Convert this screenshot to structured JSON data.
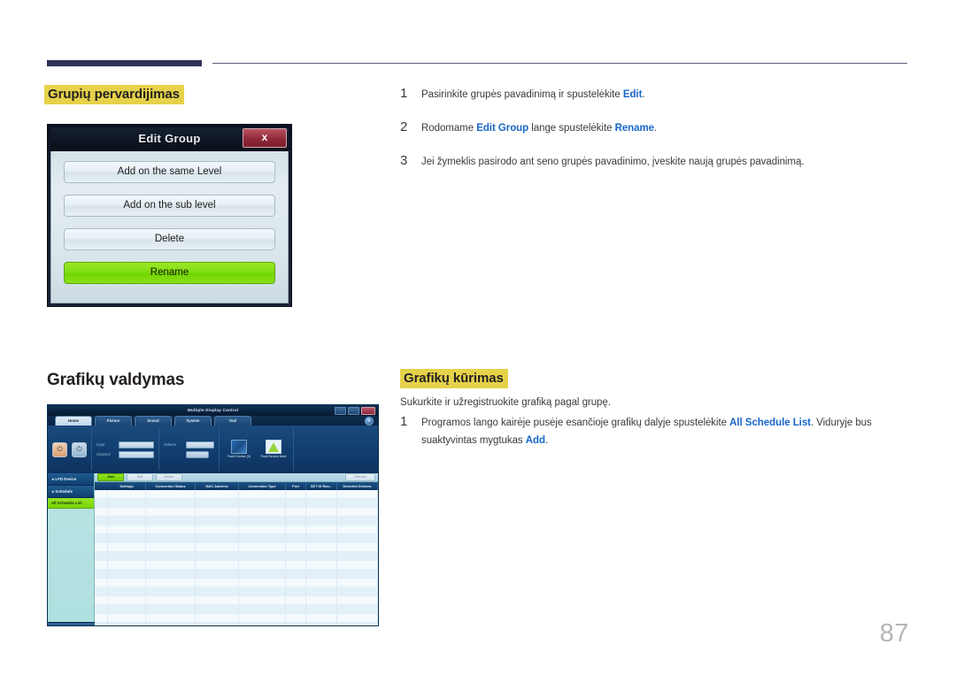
{
  "page": {
    "number": "87"
  },
  "sections": {
    "group_rename": {
      "heading": "Grupių pervardijimas",
      "steps": [
        {
          "num": "1",
          "parts": [
            {
              "t": "Pasirinkite grupės pavadinimą ir spustelėkite ",
              "b": false
            },
            {
              "t": "Edit",
              "b": true
            },
            {
              "t": ".",
              "b": false
            }
          ]
        },
        {
          "num": "2",
          "parts": [
            {
              "t": "Rodomame ",
              "b": false
            },
            {
              "t": "Edit Group",
              "b": true
            },
            {
              "t": " lange spustelėkite ",
              "b": false
            },
            {
              "t": "Rename",
              "b": true
            },
            {
              "t": ".",
              "b": false
            }
          ]
        },
        {
          "num": "3",
          "parts": [
            {
              "t": "Jei žymeklis pasirodo ant seno grupės pavadinimo, įveskite naują grupės pavadinimą.",
              "b": false
            }
          ]
        }
      ]
    },
    "schedule_management": {
      "heading": "Grafikų valdymas"
    },
    "schedule_create": {
      "heading": "Grafikų kūrimas",
      "intro": "Sukurkite ir užregistruokite grafiką pagal grupę.",
      "steps": [
        {
          "num": "1",
          "parts": [
            {
              "t": "Programos lango kairėje pusėje esančioje grafikų dalyje spustelėkite ",
              "b": false
            },
            {
              "t": "All Schedule List",
              "b": true
            },
            {
              "t": ". Viduryje bus suaktyvintas mygtukas ",
              "b": false
            },
            {
              "t": "Add",
              "b": true
            },
            {
              "t": ".",
              "b": false
            }
          ]
        }
      ]
    }
  },
  "edit_group_dialog": {
    "title": "Edit Group",
    "close_label": "x",
    "buttons": [
      {
        "label": "Add on the same Level",
        "primary": false
      },
      {
        "label": "Add on the sub level",
        "primary": false
      },
      {
        "label": "Delete",
        "primary": false
      },
      {
        "label": "Rename",
        "primary": true
      }
    ]
  },
  "mdc_app": {
    "title": "Multiple Display Control",
    "help_label": "?",
    "tabs": [
      {
        "label": "Home",
        "active": true
      },
      {
        "label": "Picture",
        "active": false
      },
      {
        "label": "Sound",
        "active": false
      },
      {
        "label": "System",
        "active": false
      },
      {
        "label": "Tool",
        "active": false
      }
    ],
    "ribbon": {
      "power_on_label": "On",
      "power_off_label": "Off",
      "fields": [
        {
          "label": "Input"
        },
        {
          "label": "Channel"
        },
        {
          "label": "Volume"
        }
      ],
      "mute_label": "Mute",
      "fault_items": [
        {
          "label": "Fault Device (0)"
        },
        {
          "label": "Fault Device Alert"
        }
      ]
    },
    "sidebar": [
      {
        "label": "LFD Device",
        "type": "header"
      },
      {
        "label": "Schedule",
        "type": "header"
      },
      {
        "label": "All Schedule List",
        "type": "active"
      }
    ],
    "toolbar": {
      "add_label": "Add",
      "edit_label": "Edit",
      "delete_label": "Delete",
      "right_label": "Refresh"
    },
    "table": {
      "columns": [
        {
          "label": "",
          "w": 14
        },
        {
          "label": "Settings",
          "w": 42
        },
        {
          "label": "Connection Status",
          "w": 55
        },
        {
          "label": "MAC Address",
          "w": 48
        },
        {
          "label": "Connection Type",
          "w": 52
        },
        {
          "label": "Port",
          "w": 22
        },
        {
          "label": "SET ID Ran...",
          "w": 34
        },
        {
          "label": "Detected Devices",
          "w": 45
        }
      ],
      "row_count": 17
    }
  }
}
